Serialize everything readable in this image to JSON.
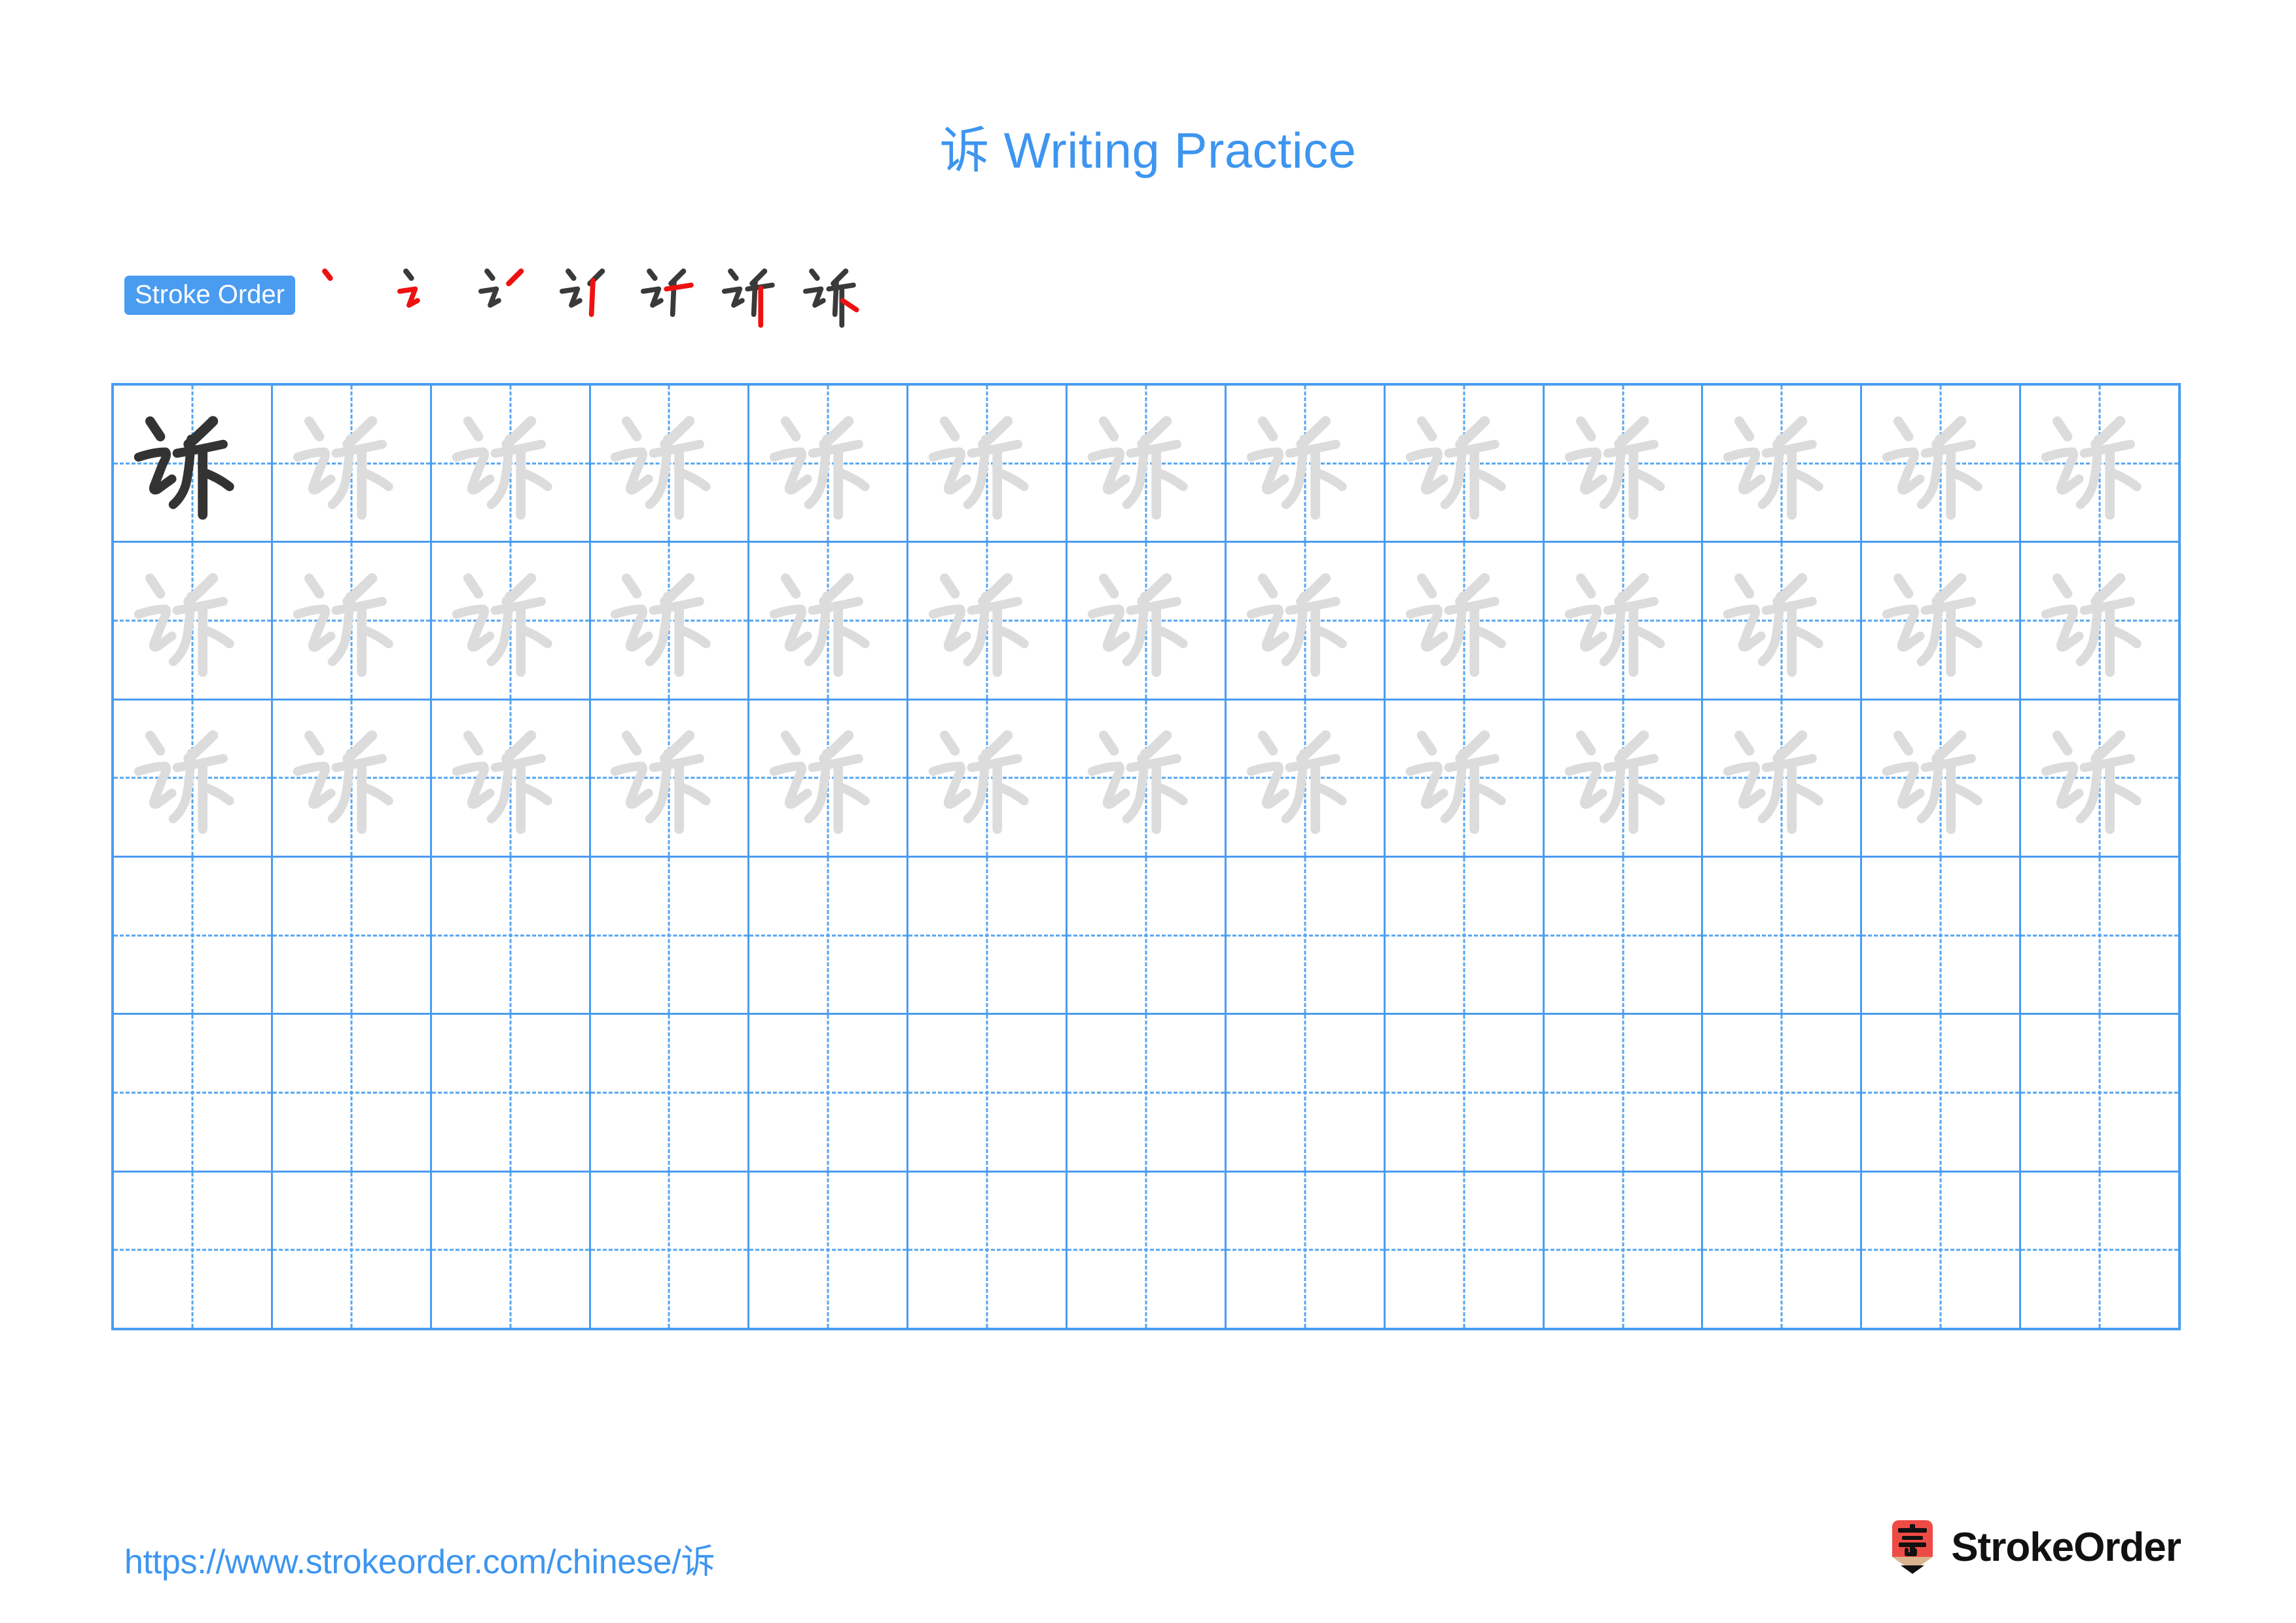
{
  "page": {
    "character": "诉",
    "title": "诉 Writing Practice",
    "background_color": "#ffffff",
    "accent_color": "#3d95f0"
  },
  "stroke_order": {
    "badge_label": "Stroke Order",
    "badge_bg_color": "#4a9cf0",
    "badge_text_color": "#ffffff",
    "total_strokes": 7,
    "new_stroke_color": "#ee1111",
    "old_stroke_color": "#3a3a3a",
    "steps": [
      {
        "index": 1,
        "strokes_shown": 1,
        "new_stroke": "diǎn (dot)"
      },
      {
        "index": 2,
        "strokes_shown": 2,
        "new_stroke": "héngzhé-tí"
      },
      {
        "index": 3,
        "strokes_shown": 3,
        "new_stroke": "piě (left-falling)"
      },
      {
        "index": 4,
        "strokes_shown": 4,
        "new_stroke": "shù (vertical)"
      },
      {
        "index": 5,
        "strokes_shown": 5,
        "new_stroke": "héng (horizontal)"
      },
      {
        "index": 6,
        "strokes_shown": 6,
        "new_stroke": "shù (vertical)"
      },
      {
        "index": 7,
        "strokes_shown": 7,
        "new_stroke": "nà / diǎn (right-falling)"
      }
    ]
  },
  "practice_grid": {
    "columns": 13,
    "rows": 6,
    "border_color": "#4a9cf0",
    "guide_color": "#56a5f2",
    "dark_glyph_color": "#333333",
    "trace_glyph_color": "#dcdcdc",
    "filled_rows": 3,
    "empty_rows": 3,
    "cells": [
      [
        "dark",
        "trace",
        "trace",
        "trace",
        "trace",
        "trace",
        "trace",
        "trace",
        "trace",
        "trace",
        "trace",
        "trace",
        "trace"
      ],
      [
        "trace",
        "trace",
        "trace",
        "trace",
        "trace",
        "trace",
        "trace",
        "trace",
        "trace",
        "trace",
        "trace",
        "trace",
        "trace"
      ],
      [
        "trace",
        "trace",
        "trace",
        "trace",
        "trace",
        "trace",
        "trace",
        "trace",
        "trace",
        "trace",
        "trace",
        "trace",
        "trace"
      ],
      [
        "empty",
        "empty",
        "empty",
        "empty",
        "empty",
        "empty",
        "empty",
        "empty",
        "empty",
        "empty",
        "empty",
        "empty",
        "empty"
      ],
      [
        "empty",
        "empty",
        "empty",
        "empty",
        "empty",
        "empty",
        "empty",
        "empty",
        "empty",
        "empty",
        "empty",
        "empty",
        "empty"
      ],
      [
        "empty",
        "empty",
        "empty",
        "empty",
        "empty",
        "empty",
        "empty",
        "empty",
        "empty",
        "empty",
        "empty",
        "empty",
        "empty"
      ]
    ]
  },
  "footer": {
    "url": "https://www.strokeorder.com/chinese/诉",
    "url_color": "#3d95f0",
    "brand_name": "StrokeOrder",
    "brand_icon": "pencil-logo-icon",
    "brand_icon_character": "字",
    "brand_icon_color": "#ef4b46",
    "brand_icon_wood_color": "#d9b48f",
    "brand_icon_tip_color": "#111111"
  }
}
